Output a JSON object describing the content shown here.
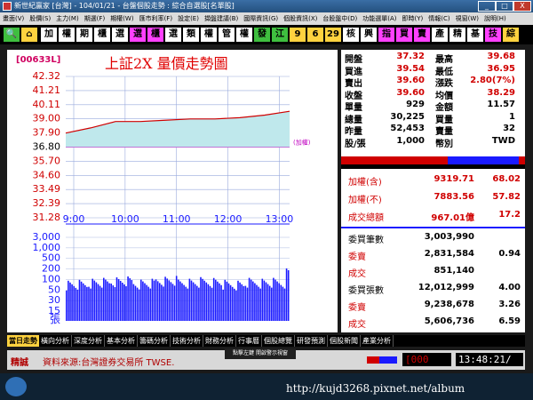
{
  "window": {
    "title": "新世紀贏家 [台灣] - 104/01/21 - 台盤個股走勢 : 綜合自選股[名單股]",
    "buttons": [
      "_",
      "□",
      "X"
    ]
  },
  "menu": [
    "畫面(V)",
    "股價(S)",
    "主力(M)",
    "期選(F)",
    "期權(W)",
    "匯市利率(F)",
    "設定(E)",
    "擷盤建議(B)",
    "國際資訊(G)",
    "個股資訊(X)",
    "台股盤中(D)",
    "功能選單(A)",
    "即時(Y)",
    "情報(C)",
    "視窗(W)",
    "說明(H)"
  ],
  "toolbar": {
    "search_icon": "search-icon",
    "home_icon": "home-icon",
    "buttons": [
      "加",
      "權",
      "期",
      "櫃",
      "選",
      "選",
      "櫃",
      "選",
      "類",
      "權",
      "管",
      "權",
      "發",
      "江",
      "9",
      "6",
      "29",
      "核",
      "興",
      "指",
      "買",
      "賣",
      "產",
      "精",
      "基",
      "技",
      "綜"
    ]
  },
  "chart": {
    "code": "[00633L]",
    "title": "上証2X  量價走勢圖",
    "price_ticks": [
      "42.32",
      "41.21",
      "40.11",
      "39.00",
      "37.90",
      "36.80",
      "35.70",
      "34.60",
      "33.49",
      "32.39",
      "31.28"
    ],
    "ref_price": "36.80",
    "ref_label": "(加權)",
    "time_labels": [
      "9:00",
      "10:00",
      "11:00",
      "12:00",
      "13:00"
    ],
    "volume_ticks": [
      "3,000",
      "1,000",
      "500",
      "200",
      "100",
      "50",
      "30",
      "15"
    ],
    "volume_unit": "張",
    "colors": {
      "up": "#d00000",
      "down": "#008000",
      "flat": "#000000",
      "volume": "#1a1aff",
      "fill": "#bfe8ec"
    }
  },
  "chart_data": {
    "type": "line",
    "x": [
      "9:00",
      "9:30",
      "10:00",
      "10:30",
      "11:00",
      "11:30",
      "12:00",
      "12:30",
      "13:00",
      "13:30"
    ],
    "y": [
      37.9,
      38.3,
      38.8,
      38.8,
      38.9,
      39.0,
      39.0,
      39.1,
      39.3,
      39.6
    ],
    "ylim": [
      31.28,
      42.32
    ],
    "reference": 36.8,
    "grid": true,
    "volume": [
      40,
      60,
      80,
      50,
      90,
      60,
      70,
      40,
      60,
      500
    ]
  },
  "quote": {
    "rows": [
      [
        {
          "l": "開盤",
          "v": "37.32",
          "c": "#d00000"
        },
        {
          "l": "最高",
          "v": "39.68",
          "c": "#d00000"
        }
      ],
      [
        {
          "l": "買進",
          "v": "39.54",
          "c": "#d00000"
        },
        {
          "l": "最低",
          "v": "36.95",
          "c": "#d00000"
        }
      ],
      [
        {
          "l": "賣出",
          "v": "39.60",
          "c": "#d00000"
        },
        {
          "l": "漲跌",
          "v": "2.80(7%)",
          "c": "#d00000"
        }
      ],
      [
        {
          "l": "收盤",
          "v": "39.60",
          "c": "#d00000"
        },
        {
          "l": "均價",
          "v": "38.29",
          "c": "#d00000"
        }
      ],
      [
        {
          "l": "單量",
          "v": "929",
          "c": "#000"
        },
        {
          "l": "金額",
          "v": "11.57",
          "c": "#000"
        }
      ],
      [
        {
          "l": "總量",
          "v": "30,225",
          "c": "#000"
        },
        {
          "l": "買量",
          "v": "1",
          "c": "#000"
        }
      ],
      [
        {
          "l": "昨量",
          "v": "52,453",
          "c": "#000"
        },
        {
          "l": "賣量",
          "v": "32",
          "c": "#000"
        }
      ],
      [
        {
          "l": "股/張",
          "v": "1,000",
          "c": "#000"
        },
        {
          "l": "幣別",
          "v": "TWD",
          "c": "#000"
        }
      ]
    ],
    "index": [
      {
        "l": "加權(含)",
        "v": "9319.71",
        "p": "68.02"
      },
      {
        "l": "加權(不)",
        "v": "7883.56",
        "p": "57.82"
      },
      {
        "l": "成交總額",
        "v": "967.01億",
        "p": "17.2"
      }
    ],
    "market": [
      {
        "l": "委買筆數",
        "v": "3,003,990",
        "p": ""
      },
      {
        "l": "委賣",
        "v": "2,831,584",
        "p": "0.94"
      },
      {
        "l": "成交",
        "v": "851,140",
        "p": ""
      },
      {
        "l": "委買張數",
        "v": "12,012,999",
        "p": "4.00"
      },
      {
        "l": "委賣",
        "v": "9,238,678",
        "p": "3.26"
      },
      {
        "l": "成交",
        "v": "5,606,736",
        "p": "6.59"
      }
    ]
  },
  "tabs": [
    "當日走勢",
    "橫向分析",
    "深度分析",
    "基本分析",
    "籌碼分析",
    "技術分析",
    "財務分析",
    "行事曆",
    "個股總覽",
    "研發預測",
    "個股新聞",
    "產業分析"
  ],
  "tooltip": "點擊左鍵 開啟警示視窗",
  "status": {
    "left": "精誠",
    "source": "資料來源:台灣證券交易所 TWSE.",
    "code": "[000",
    "time": "13:48:21/"
  },
  "watermark": "http://kujd3268.pixnet.net/album"
}
